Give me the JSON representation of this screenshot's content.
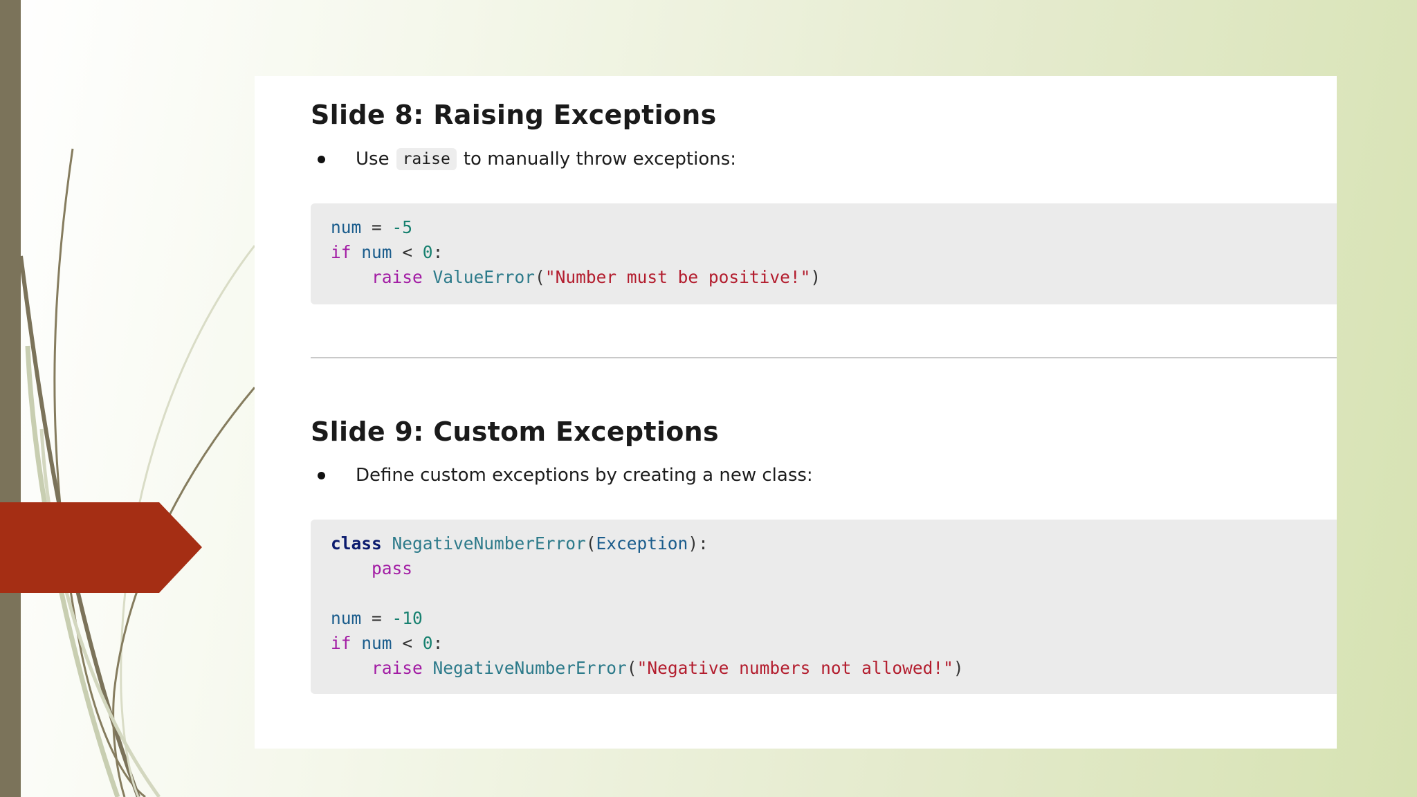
{
  "slide8": {
    "title": "Slide 8: Raising Exceptions",
    "bullet_before": "Use",
    "bullet_code": "raise",
    "bullet_after": "to manually throw exceptions:",
    "code": {
      "l1_var": "num",
      "l1_eq": " = ",
      "l1_val": "-5",
      "l2_kw": "if",
      "l2_var": " num",
      "l2_op": " < ",
      "l2_val": "0",
      "l2_colon": ":",
      "l3_indent": "    ",
      "l3_kw": "raise",
      "l3_cls": " ValueError",
      "l3_paren_open": "(",
      "l3_str": "\"Number must be positive!\"",
      "l3_paren_close": ")"
    }
  },
  "slide9": {
    "title": "Slide 9: Custom Exceptions",
    "bullet": "Define custom exceptions by creating a new class:",
    "code": {
      "l1_kw": "class",
      "l1_cls": " NegativeNumberError",
      "l1_paren_open": "(",
      "l1_base": "Exception",
      "l1_paren_close": "):",
      "l2_indent": "    ",
      "l2_kw": "pass",
      "l4_var": "num",
      "l4_eq": " = ",
      "l4_val": "-10",
      "l5_kw": "if",
      "l5_var": " num",
      "l5_op": " < ",
      "l5_val": "0",
      "l5_colon": ":",
      "l6_indent": "    ",
      "l6_kw": "raise",
      "l6_cls": " NegativeNumberError",
      "l6_paren_open": "(",
      "l6_str": "\"Negative numbers not allowed!\"",
      "l6_paren_close": ")"
    }
  },
  "colors": {
    "accent_arrow": "#a52e14",
    "left_bar": "#7b735a",
    "code_bg": "#ebebeb"
  }
}
